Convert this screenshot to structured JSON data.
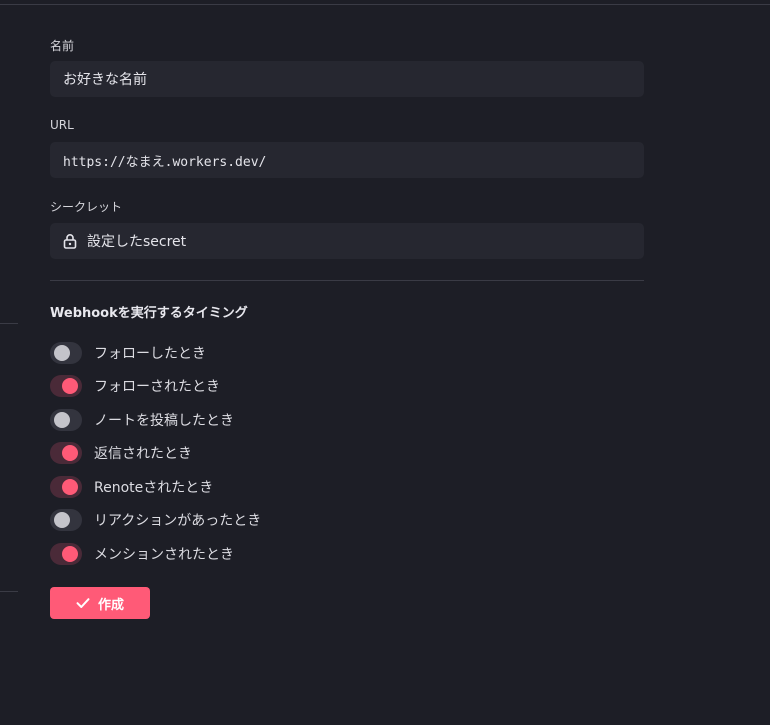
{
  "form": {
    "name": {
      "label": "名前",
      "value": "お好きな名前"
    },
    "url": {
      "label": "URL",
      "value": "https://なまえ.workers.dev/"
    },
    "secret": {
      "label": "シークレット",
      "value": "設定したsecret",
      "icon": "lock-icon"
    },
    "events_title": "Webhookを実行するタイミング",
    "events": [
      {
        "label": "フォローしたとき",
        "enabled": false
      },
      {
        "label": "フォローされたとき",
        "enabled": true
      },
      {
        "label": "ノートを投稿したとき",
        "enabled": false
      },
      {
        "label": "返信されたとき",
        "enabled": true
      },
      {
        "label": "Renoteされたとき",
        "enabled": true
      },
      {
        "label": "リアクションがあったとき",
        "enabled": false
      },
      {
        "label": "メンションされたとき",
        "enabled": true
      }
    ],
    "submit_label": "作成",
    "submit_icon": "check-icon"
  },
  "colors": {
    "background": "#1d1e26",
    "field": "#262730",
    "accent": "#ff5a77",
    "toggle_off": "#33343e",
    "toggle_on_track": "#4a2a38"
  }
}
